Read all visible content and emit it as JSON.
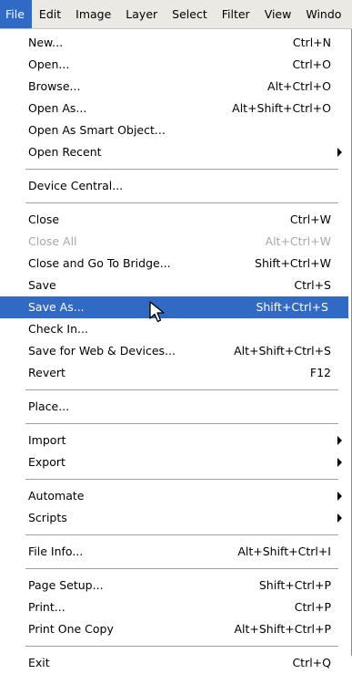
{
  "menubar": {
    "items": [
      {
        "label": "File"
      },
      {
        "label": "Edit"
      },
      {
        "label": "Image"
      },
      {
        "label": "Layer"
      },
      {
        "label": "Select"
      },
      {
        "label": "Filter"
      },
      {
        "label": "View"
      },
      {
        "label": "Windo"
      }
    ]
  },
  "file_menu": {
    "new": {
      "label": "New...",
      "shortcut": "Ctrl+N"
    },
    "open": {
      "label": "Open...",
      "shortcut": "Ctrl+O"
    },
    "browse": {
      "label": "Browse...",
      "shortcut": "Alt+Ctrl+O"
    },
    "open_as": {
      "label": "Open As...",
      "shortcut": "Alt+Shift+Ctrl+O"
    },
    "open_smart": {
      "label": "Open As Smart Object..."
    },
    "open_recent": {
      "label": "Open Recent"
    },
    "device_central": {
      "label": "Device Central..."
    },
    "close": {
      "label": "Close",
      "shortcut": "Ctrl+W"
    },
    "close_all": {
      "label": "Close All",
      "shortcut": "Alt+Ctrl+W"
    },
    "close_bridge": {
      "label": "Close and Go To Bridge...",
      "shortcut": "Shift+Ctrl+W"
    },
    "save": {
      "label": "Save",
      "shortcut": "Ctrl+S"
    },
    "save_as": {
      "label": "Save As...",
      "shortcut": "Shift+Ctrl+S"
    },
    "check_in": {
      "label": "Check In..."
    },
    "save_web": {
      "label": "Save for Web & Devices...",
      "shortcut": "Alt+Shift+Ctrl+S"
    },
    "revert": {
      "label": "Revert",
      "shortcut": "F12"
    },
    "place": {
      "label": "Place..."
    },
    "import": {
      "label": "Import"
    },
    "export": {
      "label": "Export"
    },
    "automate": {
      "label": "Automate"
    },
    "scripts": {
      "label": "Scripts"
    },
    "file_info": {
      "label": "File Info...",
      "shortcut": "Alt+Shift+Ctrl+I"
    },
    "page_setup": {
      "label": "Page Setup...",
      "shortcut": "Shift+Ctrl+P"
    },
    "print": {
      "label": "Print...",
      "shortcut": "Ctrl+P"
    },
    "print_one": {
      "label": "Print One Copy",
      "shortcut": "Alt+Shift+Ctrl+P"
    },
    "exit": {
      "label": "Exit",
      "shortcut": "Ctrl+Q"
    }
  },
  "colors": {
    "highlight": "#316ac5",
    "menubar_bg": "#ebe9e3",
    "disabled_text": "#a8a8a8"
  },
  "icons": {
    "cursor": "mouse-pointer-icon",
    "submenu": "submenu-arrow-icon"
  }
}
